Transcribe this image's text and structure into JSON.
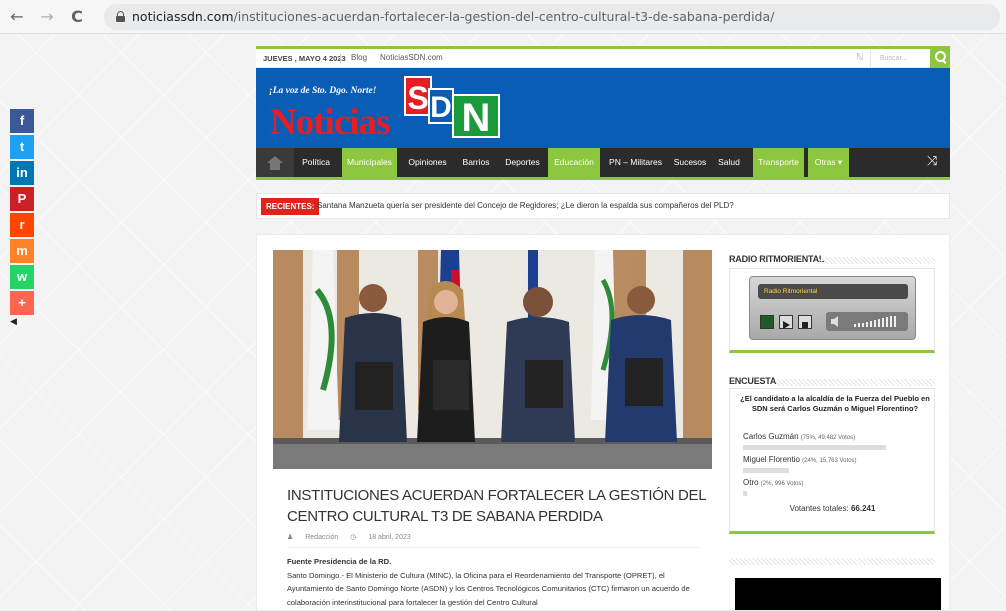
{
  "browser": {
    "back": "←",
    "forward": "→",
    "reload": "C",
    "url_domain": "noticiassdn.com",
    "url_path": "/instituciones-acuerdan-fortalecer-la-gestion-del-centro-cultural-t3-de-sabana-perdida/"
  },
  "share": {
    "items": [
      {
        "name": "facebook",
        "glyph": "f",
        "color": "#3b5998"
      },
      {
        "name": "twitter",
        "glyph": "t",
        "color": "#1da1f2"
      },
      {
        "name": "linkedin",
        "glyph": "in",
        "color": "#0077b5"
      },
      {
        "name": "pinterest",
        "glyph": "P",
        "color": "#cb2027"
      },
      {
        "name": "reddit",
        "glyph": "r",
        "color": "#ff4500"
      },
      {
        "name": "mix",
        "glyph": "m",
        "color": "#ff8226"
      },
      {
        "name": "whatsapp",
        "glyph": "w",
        "color": "#25d366"
      },
      {
        "name": "more",
        "glyph": "+",
        "color": "#ff6550"
      }
    ],
    "collapse": "◀"
  },
  "topbar": {
    "date": "JUEVES , MAYO 4 2023",
    "links": [
      "Blog",
      "NoticiasSDN.com"
    ],
    "search_placeholder": "Buscar..."
  },
  "header": {
    "tagline": "¡La voz de Sto. Dgo. Norte!",
    "logo_word": "Noticias",
    "logo_letters": [
      "S",
      "D",
      "N"
    ],
    "colors": {
      "blue": "#0a5db5",
      "red": "#e51d24",
      "green": "#1a9a3a",
      "accent": "#8dc63f"
    }
  },
  "menu": {
    "items": [
      {
        "label": "Política",
        "active": false
      },
      {
        "label": "Municipales",
        "active": true
      },
      {
        "label": "Opiniones",
        "active": false
      },
      {
        "label": "Barrios",
        "active": false
      },
      {
        "label": "Deportes",
        "active": false
      },
      {
        "label": "Educación",
        "active": true
      },
      {
        "label": "PN – Militares",
        "active": false
      },
      {
        "label": "Sucesos",
        "active": false
      },
      {
        "label": "Salud",
        "active": false
      },
      {
        "label": "Transporte",
        "active": true
      },
      {
        "label": "Otras ▾",
        "active": true
      }
    ]
  },
  "ticker": {
    "label": "RECIENTES:",
    "text": "Santana Manzueta quería ser presidente del Concejo de Regidores; ¿Le dieron la espalda sus compañeros del PLD?"
  },
  "article": {
    "title": "INSTITUCIONES ACUERDAN FORTALECER LA GESTIÓN DEL CENTRO CULTURAL T3 DE SABANA PERDIDA",
    "author": "Redacción",
    "date": "18 abril, 2023",
    "source": "Fuente Presidencia de la RD.",
    "body": "Santo Domingo.- El Ministerio de Cultura (MINC), la Oficina para el Reordenamiento del Transporte (OPRET), el Ayuntamiento de Santo Domingo Norte (ASDN) y los Centros Tecnológicos Comunitarios (CTC) firmaron un acuerdo de colaboración interinstitucional para fortalecer la gestión del Centro Cultural"
  },
  "sidebar": {
    "radio_title": "RADIO RITMORIENTAL",
    "radio_station": "Radio Ritmoriental",
    "poll_title": "ENCUESTA",
    "poll_question": "¿El candidato a la alcaldía de la Fuerza del Pueblo en SDN será Carlos Guzmán o Miguel Florentino?",
    "poll_options": [
      {
        "label": "Carlos Guzmán",
        "stats": "(75%, 49.482 Votos)",
        "percent": 75
      },
      {
        "label": "Miguel Florentio",
        "stats": "(24%, 15.763 Votos)",
        "percent": 24
      },
      {
        "label": "Otro",
        "stats": "(2%, 996 Votos)",
        "percent": 2
      }
    ],
    "poll_total_label": "Votantes totales:",
    "poll_total_value": "66.241"
  }
}
